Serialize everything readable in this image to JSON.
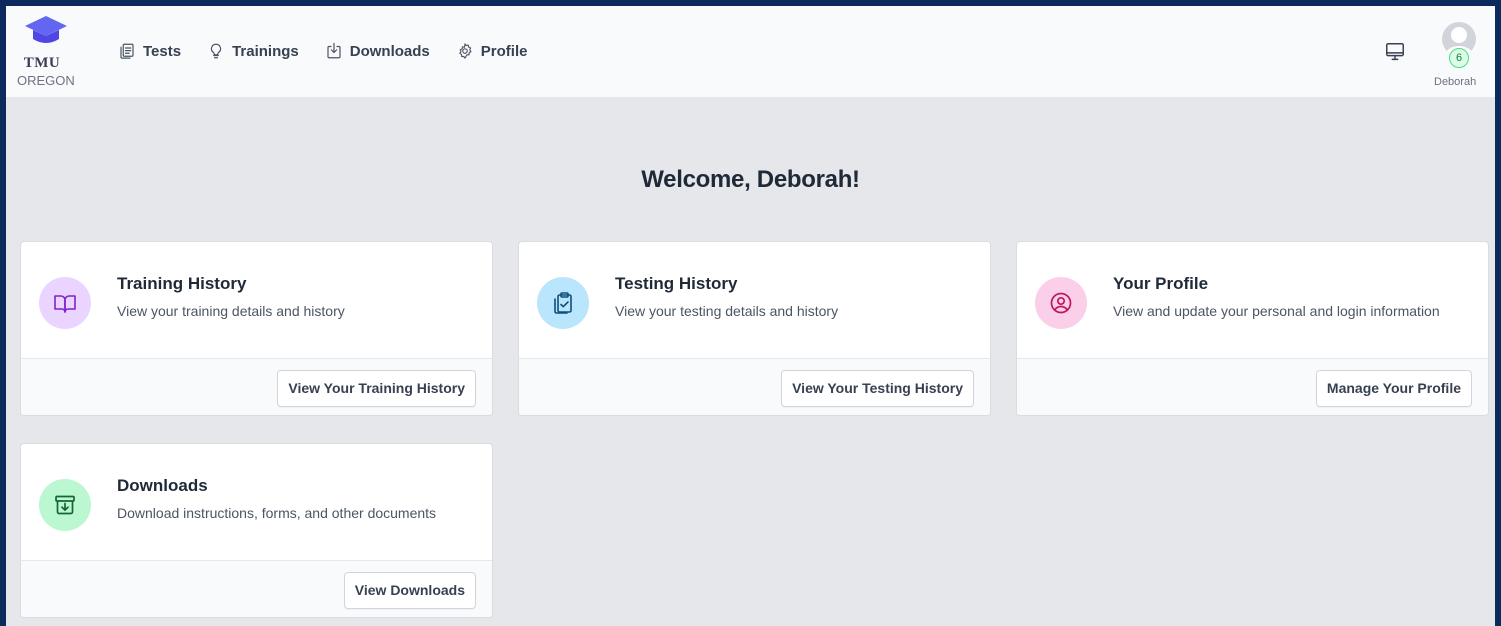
{
  "brand": {
    "name": "TMU",
    "region": "OREGON"
  },
  "nav": [
    {
      "label": "Tests",
      "icon": "clipboard-list-icon"
    },
    {
      "label": "Trainings",
      "icon": "lightbulb-icon"
    },
    {
      "label": "Downloads",
      "icon": "download-icon"
    },
    {
      "label": "Profile",
      "icon": "gear-icon"
    }
  ],
  "user": {
    "name": "Deborah",
    "badge_count": "6"
  },
  "welcome": "Welcome, Deborah!",
  "colors": {
    "brand_cap": "#6366f1",
    "page_bg": "#e5e7eb",
    "training_icon_bg": "#e9d5ff",
    "testing_icon_bg": "#bae6fd",
    "profile_icon_bg": "#fbcfe8",
    "downloads_icon_bg": "#bbf7d0"
  },
  "cards": [
    {
      "title": "Training History",
      "description": "View your training details and history",
      "button": "View Your Training History",
      "icon": "book-open-icon"
    },
    {
      "title": "Testing History",
      "description": "View your testing details and history",
      "button": "View Your Testing History",
      "icon": "clipboard-check-icon"
    },
    {
      "title": "Your Profile",
      "description": "View and update your personal and login information",
      "button": "Manage Your Profile",
      "icon": "user-circle-icon"
    },
    {
      "title": "Downloads",
      "description": "Download instructions, forms, and other documents",
      "button": "View Downloads",
      "icon": "archive-download-icon"
    }
  ]
}
